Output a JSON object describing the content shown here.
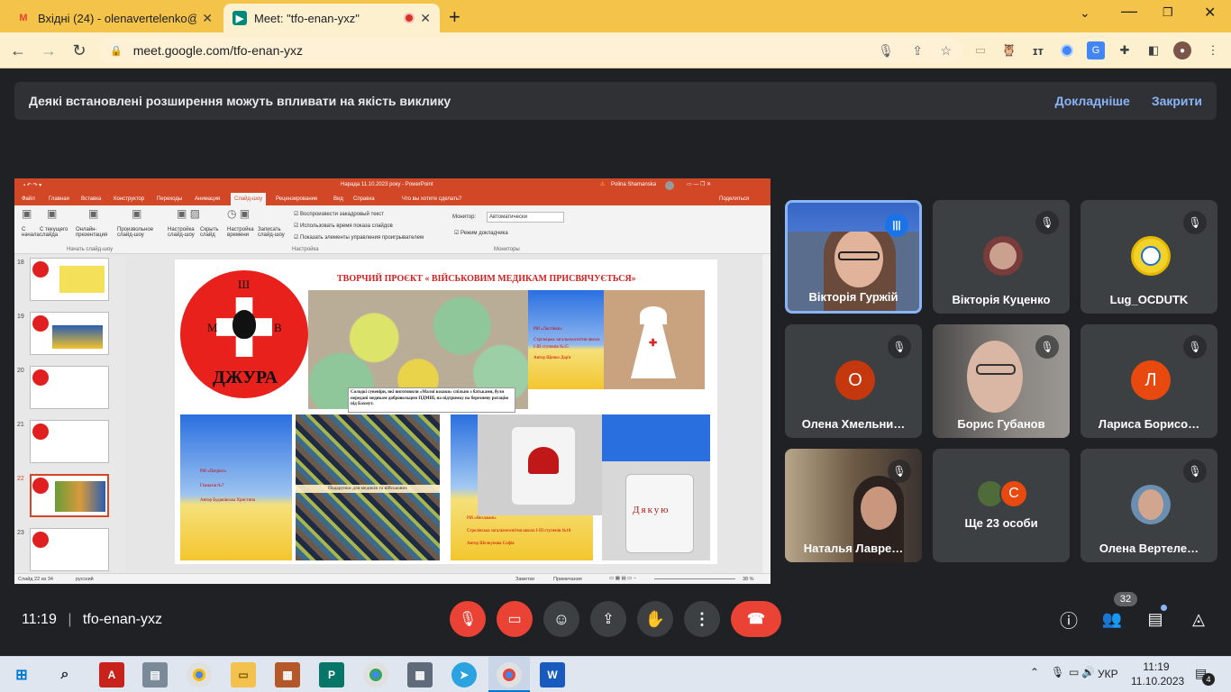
{
  "browser": {
    "tabs": [
      {
        "title": "Вхідні (24) - olenavertelenko@g",
        "favicon": "gmail-icon"
      },
      {
        "title": "Meet: \"tfo-enan-yxz\"",
        "favicon": "meet-icon"
      }
    ],
    "url": "meet.google.com/tfo-enan-yxz"
  },
  "banner": {
    "text": "Деякі встановлені розширення можуть впливати на якість виклику",
    "more": "Докладніше",
    "close": "Закрити"
  },
  "ppt": {
    "title": "Нарада 11.10.2023 року  -  PowerPoint",
    "user": "Polina Shamanska",
    "tabs": [
      "Файл",
      "Главная",
      "Вставка",
      "Конструктор",
      "Переходы",
      "Анимация",
      "Слайд-шоу",
      "Рецензирование",
      "Вид",
      "Справка",
      "Что вы хотите сделать?"
    ],
    "share": "Поделиться",
    "ribbon": {
      "b1": "С начала",
      "b2": "С текущего слайда",
      "b3": "Онлайн-презентация",
      "b4": "Произвольное слайд-шоу",
      "g1": "Начать слайд-шоу",
      "b5": "Настройка слайд-шоу",
      "b6": "Скрыть слайд",
      "b7": "Настройка времени",
      "b8": "Записать слайд-шоу",
      "c1": "Воспроизвести закадровый текст",
      "c2": "Использовать время показа слайдов",
      "c3": "Показать элементы управления проигрывателем",
      "g2": "Настройка",
      "mon_label": "Монитор:",
      "mon_value": "Автоматически",
      "c4": "Режим докладчика",
      "g3": "Мониторы"
    },
    "thumbs": [
      "18",
      "19",
      "20",
      "21",
      "22",
      "23"
    ],
    "slide": {
      "title": "ТВОРЧИЙ ПРОЄКТ « ВІЙСЬКОВИМ МЕДИКАМ ПРИСВЯЧУЄТЬСЯ»",
      "logo_text": "ДЖУРА",
      "logo_letters": [
        "Ш",
        "М",
        "В"
      ],
      "caption": "Солодкі сувеніри, які виготовили «Малої козаки» спільно з батьками, були передані медикам-добровольцям ПДМШ, на підтримку на березневу ротацію під Бахмут.",
      "card1": [
        "Рій «Ластівки»",
        "Стрілецька загальноосвітня школа І-ІІІ ступенів №15",
        "Автор Щенко Дар'я"
      ],
      "card2": [
        "Рій «Патріот»",
        "Гімназія №7",
        "Автор Будаківська Христина"
      ],
      "socks": "Подарунки для медиків та військових",
      "card3": [
        "Рій «Незламні»",
        "Стрелівська загальноосвітня школа І-ІІІ ступенів №18",
        "Автор Шелкунова Софія"
      ],
      "cup_text": "Дякую"
    },
    "status_left": "Слайд 22 из 34",
    "status_lang": "русский",
    "status_notes": "Заметки",
    "status_comments": "Примечания",
    "zoom": "38 %"
  },
  "tiles": [
    {
      "name": "Вікторія Гуржій",
      "speaking": true
    },
    {
      "name": "Вікторія Куценко",
      "muted": true
    },
    {
      "name": "Lug_OCDUTK",
      "muted": true
    },
    {
      "name": "Олена Хмельни…",
      "avatar_letter": "О",
      "muted": true
    },
    {
      "name": "Борис Губанов",
      "muted": true
    },
    {
      "name": "Лариса Борисо…",
      "avatar_letter": "Л",
      "muted": true
    },
    {
      "name": "Наталья Лавре…",
      "muted": true
    },
    {
      "name": "Ще 23 особи",
      "avatar_letter": "С"
    },
    {
      "name": "Олена Вертеле…",
      "muted": true
    }
  ],
  "meeting": {
    "time": "11:19",
    "code": "tfo-enan-yxz",
    "participants": "32"
  },
  "taskbar": {
    "lang": "УКР",
    "time": "11:19",
    "date": "11.10.2023",
    "notif": "4"
  },
  "colors": {
    "accent": "#f4c34a",
    "ppt": "#d24726",
    "red": "#ea4335",
    "orange": "#e8490f"
  }
}
